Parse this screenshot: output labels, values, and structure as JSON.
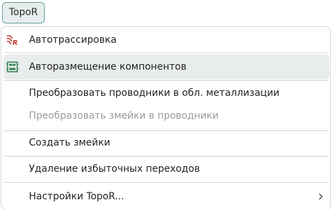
{
  "menubar": {
    "button_label": "TopoR"
  },
  "menu": {
    "items": [
      {
        "label": "Автотрассировка",
        "icon": "autorouting-icon"
      },
      {
        "label": "Авторазмещение компонентов",
        "icon": "autoplacement-icon"
      },
      {
        "label": "Преобразовать проводники в обл. металлизации"
      },
      {
        "label": "Преобразовать змейки в проводники"
      },
      {
        "label": "Создать змейки"
      },
      {
        "label": "Удаление избыточных переходов"
      },
      {
        "label": "Настройки TopoR...",
        "icon": "chevron-right-icon"
      }
    ]
  },
  "colors": {
    "accent": "#5f9f98",
    "autorouting_icon": "#c0392b",
    "autoplacement_icon": "#2e7d4f",
    "disabled_text": "#9a9a9a"
  }
}
